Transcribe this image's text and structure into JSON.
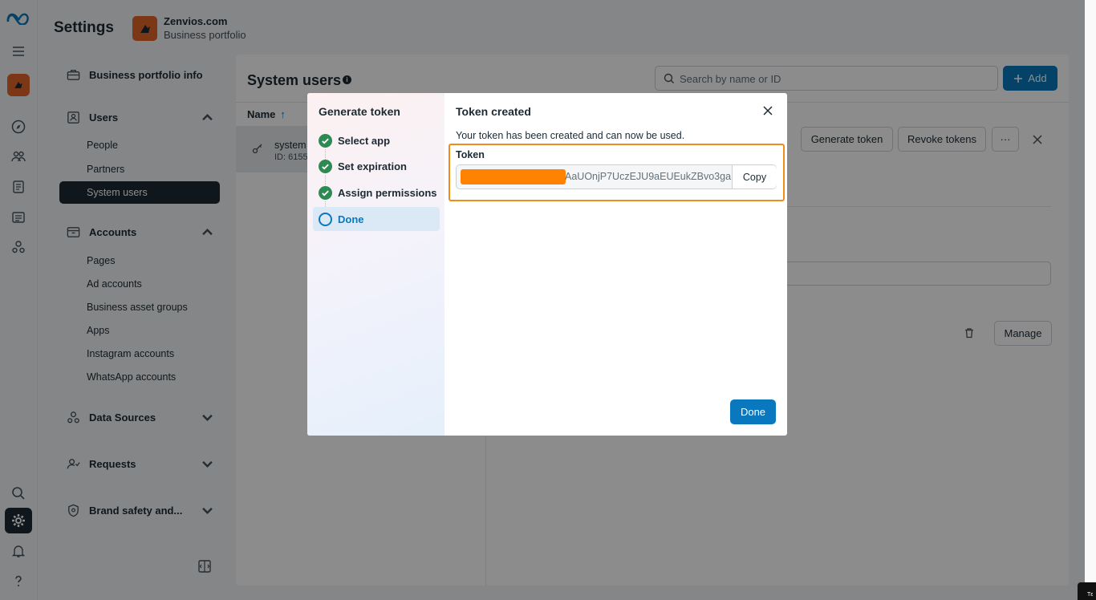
{
  "header": {
    "title": "Settings",
    "business_name": "Zenvios.com",
    "business_sub": "Business portfolio"
  },
  "nav": {
    "portfolio_info": "Business portfolio info",
    "users": {
      "label": "Users",
      "items": [
        "People",
        "Partners",
        "System users"
      ]
    },
    "accounts": {
      "label": "Accounts",
      "items": [
        "Pages",
        "Ad accounts",
        "Business asset groups",
        "Apps",
        "Instagram accounts",
        "WhatsApp accounts"
      ]
    },
    "data_sources": "Data Sources",
    "requests": "Requests",
    "brand_safety": "Brand safety and..."
  },
  "main": {
    "title": "System users",
    "search_placeholder": "Search by name or ID",
    "add_label": "Add",
    "col_name": "Name",
    "row": {
      "name": "system",
      "id": "ID: 6155"
    },
    "generate_token": "Generate token",
    "revoke_tokens": "Revoke tokens",
    "more": "···",
    "manage": "Manage"
  },
  "modal": {
    "steps_title": "Generate token",
    "steps": [
      "Select app",
      "Set expiration",
      "Assign permissions",
      "Done"
    ],
    "title": "Token created",
    "description": "Your token has been created and can now be used.",
    "token_label": "Token",
    "token_value": "AaUOnjP7UczEJU9aEUEukZBvo3ga",
    "copy_label": "Copy",
    "done_label": "Done"
  },
  "colors": {
    "accent": "#0a78be",
    "success": "#2c8a52",
    "highlight": "#f08c1a",
    "redaction": "#ff8300",
    "brand": "#e2652a"
  },
  "corner_text": "Tε"
}
